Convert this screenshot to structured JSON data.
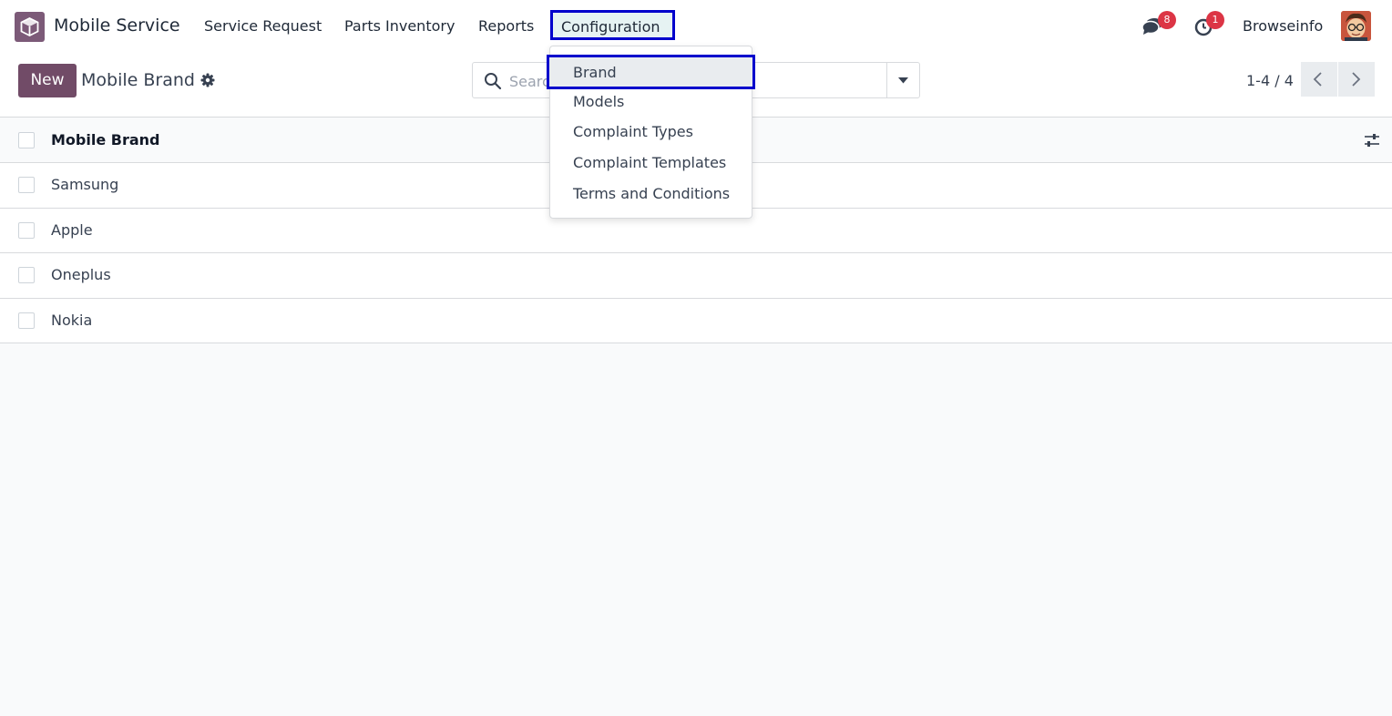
{
  "navbar": {
    "app_name": "Mobile Service",
    "menu": [
      "Service Request",
      "Parts Inventory",
      "Reports",
      "Configuration"
    ],
    "messages_badge": "8",
    "activities_badge": "1",
    "user_name": "Browseinfo"
  },
  "control_panel": {
    "new_label": "New",
    "title": "Mobile Brand",
    "search_placeholder": "Search...",
    "pager": "1-4 / 4"
  },
  "list": {
    "column_header": "Mobile Brand",
    "rows": [
      "Samsung",
      "Apple",
      "Oneplus",
      "Nokia"
    ]
  },
  "config_dropdown": {
    "items": [
      "Brand",
      "Models",
      "Complaint Types",
      "Complaint Templates",
      "Terms and Conditions"
    ],
    "active_item": "Brand"
  },
  "colors": {
    "brand": "#714b67",
    "highlight_border": "#0000cc",
    "badge": "#dc3545"
  }
}
